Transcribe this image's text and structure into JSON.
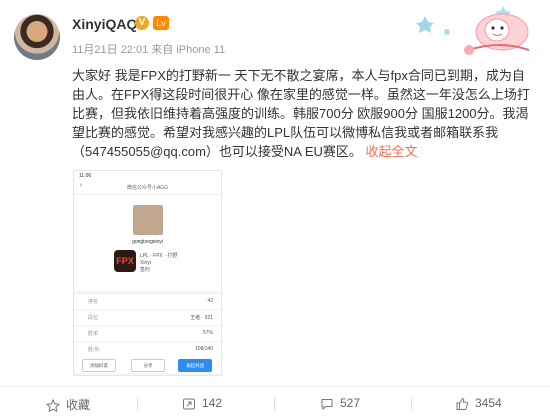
{
  "header": {
    "username": "XinyiQAQ",
    "verified_badge": "V",
    "level_badge": "Lv",
    "meta": "11月21日 22:01 来自 iPhone 11"
  },
  "post": {
    "text": "大家好 我是FPX的打野新一 天下无不散之宴席，本人与fpx合同已到期，成为自由人。在FPX得这段时间很开心 像在家里的感觉一样。虽然这一年没怎么上场打比赛，但我依旧维持着高强度的训练。韩服700分 欧服900分 国服1200分。我渴望比赛的感觉。希望对我感兴趣的LPL队伍可以微博私信我或者邮箱联系我（547455055@qq.com）也可以接受NA EU赛区。",
    "collapse_link": "收起全文"
  },
  "screenshot": {
    "time": "11:06",
    "title": "微信公众号小AGG",
    "username": "gongtongxinyi",
    "logo": "FPX",
    "info_line1": "LPL · FPX · 打野",
    "info_line2": "Xinyi",
    "info_line3": "签约",
    "rows": [
      {
        "k": "排名",
        "v": "42"
      },
      {
        "k": "段位",
        "v": "王者 · 921"
      },
      {
        "k": "胜率",
        "v": "57%"
      },
      {
        "k": "胜/负",
        "v": "108/140"
      }
    ],
    "btn_left": "添加好友",
    "btn_mid": "分享",
    "btn_right": "发起对战"
  },
  "actions": {
    "favorite": "收藏",
    "repost": "142",
    "comment": "527",
    "like": "3454"
  }
}
